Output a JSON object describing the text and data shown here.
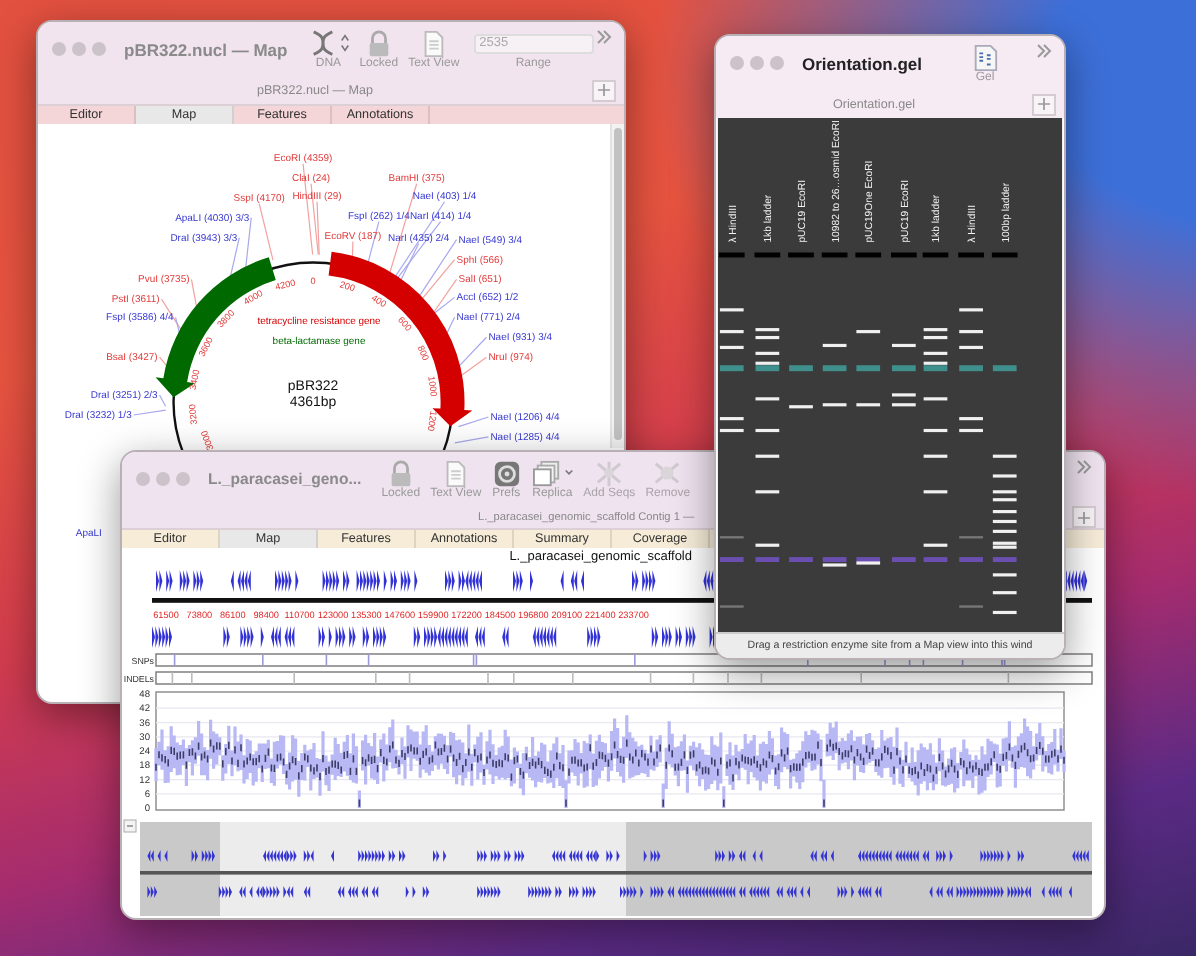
{
  "map_window": {
    "title": "pBR322.nucl — Map",
    "toolbar": [
      {
        "kind": "dna",
        "label": "DNA"
      },
      {
        "kind": "lock",
        "label": "Locked"
      },
      {
        "kind": "doc",
        "label": "Text View"
      }
    ],
    "range": {
      "value": "2535",
      "label": "Range"
    },
    "subtitle": "pBR322.nucl — Map",
    "tabs": [
      {
        "label": "Editor",
        "selected": false
      },
      {
        "label": "Map",
        "selected": true
      },
      {
        "label": "Features",
        "selected": false
      },
      {
        "label": "Annotations",
        "selected": false
      }
    ],
    "plasmid": {
      "name": "pBR322",
      "length": "4361bp",
      "features": [
        {
          "label": "tetracycline resistance gene",
          "color": "#d40000"
        },
        {
          "label": "beta-lactamase gene",
          "color": "#006a00"
        }
      ],
      "ticks": [
        "0",
        "200",
        "400",
        "600",
        "800",
        "1000",
        "1200",
        "4200",
        "4000",
        "3800",
        "3600",
        "3400",
        "3200",
        "3000"
      ],
      "sites": [
        {
          "label": "EcoRI (4359)",
          "kind": "single"
        },
        {
          "label": "ClaI (24)",
          "kind": "single"
        },
        {
          "label": "HindIII (29)",
          "kind": "single"
        },
        {
          "label": "BamHI (375)",
          "kind": "single"
        },
        {
          "label": "NaeI (403) 1/4",
          "kind": "multiple"
        },
        {
          "label": "FspI (262) 1/4",
          "kind": "multiple"
        },
        {
          "label": "NarI (414) 1/4",
          "kind": "multiple"
        },
        {
          "label": "EcoRV (187)",
          "kind": "single"
        },
        {
          "label": "NarI (435) 2/4",
          "kind": "multiple"
        },
        {
          "label": "NaeI (549) 3/4",
          "kind": "multiple"
        },
        {
          "label": "SphI (566)",
          "kind": "single"
        },
        {
          "label": "SalI (651)",
          "kind": "single"
        },
        {
          "label": "AccI (652) 1/2",
          "kind": "multiple"
        },
        {
          "label": "NaeI (771) 2/4",
          "kind": "multiple"
        },
        {
          "label": "NaeI (931) 3/4",
          "kind": "multiple"
        },
        {
          "label": "NruI (974)",
          "kind": "single"
        },
        {
          "label": "NaeI (1206) 4/4",
          "kind": "multiple"
        },
        {
          "label": "NaeI (1285) 4/4",
          "kind": "multiple"
        },
        {
          "label": "SspI (4170)",
          "kind": "single"
        },
        {
          "label": "ApaLI (4030) 3/3",
          "kind": "multiple"
        },
        {
          "label": "DraI (3943) 3/3",
          "kind": "multiple"
        },
        {
          "label": "PvuI (3735)",
          "kind": "single"
        },
        {
          "label": "PstI (3611)",
          "kind": "single"
        },
        {
          "label": "FspI (3586) 4/4",
          "kind": "multiple"
        },
        {
          "label": "BsaI (3427)",
          "kind": "single"
        },
        {
          "label": "DraI (3251) 2/3",
          "kind": "multiple"
        },
        {
          "label": "DraI (3232) 1/3",
          "kind": "multiple"
        },
        {
          "label": "ApaLI",
          "kind": "multiple"
        }
      ]
    }
  },
  "gel_window": {
    "title": "Orientation.gel",
    "toolbar": [
      {
        "kind": "gel",
        "label": "Gel"
      }
    ],
    "subtitle": "Orientation.gel",
    "lanes": [
      {
        "label": "λ HindIII"
      },
      {
        "label": "1kb ladder"
      },
      {
        "label": "pUC19 EcoRI"
      },
      {
        "label": "10982 to 26…osmid EcoRI"
      },
      {
        "label": "pUC19One EcoRI"
      },
      {
        "label": "pUC19 EcoRI"
      },
      {
        "label": "1kb ladder"
      },
      {
        "label": "λ HindIII"
      },
      {
        "label": "100bp ladder"
      }
    ],
    "hint": "Drag a restriction enzyme site from a Map view into this wind"
  },
  "genome_window": {
    "title": "L._paracasei_geno...",
    "toolbar": [
      {
        "kind": "lock",
        "label": "Locked",
        "disabled": false
      },
      {
        "kind": "doc",
        "label": "Text View",
        "disabled": false
      },
      {
        "kind": "prefs",
        "label": "Prefs",
        "disabled": false
      },
      {
        "kind": "replica",
        "label": "Replica",
        "disabled": false
      },
      {
        "kind": "addseq",
        "label": "Add Seqs",
        "disabled": true
      },
      {
        "kind": "remove",
        "label": "Remove",
        "disabled": true
      }
    ],
    "subtitle": "L._paracasei_genomic_scaffold Contig 1 —",
    "tabs": [
      {
        "label": "Editor",
        "selected": false
      },
      {
        "label": "Map",
        "selected": true
      },
      {
        "label": "Features",
        "selected": false
      },
      {
        "label": "Annotations",
        "selected": false
      },
      {
        "label": "Summary",
        "selected": false
      },
      {
        "label": "Coverage",
        "selected": false
      }
    ],
    "sequence_name": "L._paracasei_genomic_scaffold",
    "ruler": [
      "61500",
      "73800",
      "86100",
      "98400",
      "110700",
      "123000",
      "135300",
      "147600",
      "159900",
      "172200",
      "184500",
      "196800",
      "209100",
      "221400",
      "233700"
    ],
    "tracks": [
      "SNPs",
      "INDELs"
    ],
    "coverage_yticks": [
      "48",
      "42",
      "36",
      "30",
      "24",
      "18",
      "12",
      "6",
      "0"
    ]
  }
}
